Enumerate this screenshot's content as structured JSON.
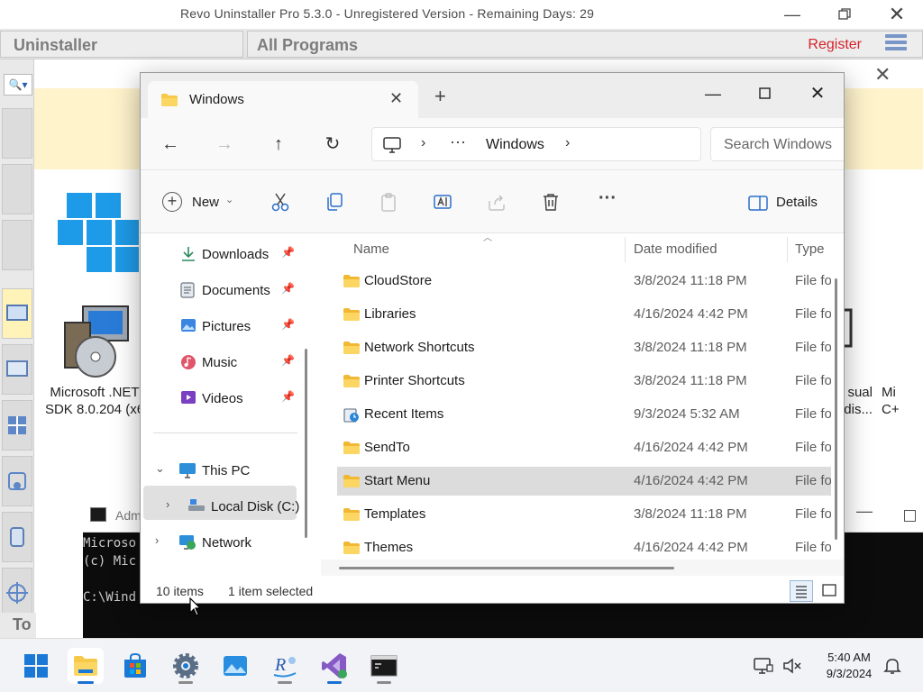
{
  "revo": {
    "title": "Revo Uninstaller Pro 5.3.0 - Unregistered Version - Remaining Days: 29",
    "uninstaller_tab": "Uninstaller",
    "all_programs_tab": "All Programs",
    "register": "Register",
    "programs": [
      {
        "label_line1": "Microsoft .NET",
        "label_line2": "SDK 8.0.204 (x6"
      },
      {
        "label_line1": "sual",
        "label_line2": "edis..."
      },
      {
        "label_line1": "Mi",
        "label_line2": "C+"
      }
    ],
    "bottom_label": "To"
  },
  "cmd": {
    "title": "Adm",
    "lines": [
      "Microso",
      "(c) Mic",
      "",
      "C:\\Wind"
    ]
  },
  "explorer": {
    "tab_title": "Windows",
    "new_tab": "+",
    "nav": {
      "back": "←",
      "forward": "→",
      "up": "↑",
      "refresh": "↻"
    },
    "address": {
      "ellipsis": "···",
      "crumb": "Windows"
    },
    "search_placeholder": "Search Windows",
    "toolbar": {
      "new_label": "New",
      "details_label": "Details",
      "more": "···"
    },
    "sidebar": {
      "quick": [
        {
          "label": "Downloads"
        },
        {
          "label": "Documents"
        },
        {
          "label": "Pictures"
        },
        {
          "label": "Music"
        },
        {
          "label": "Videos"
        }
      ],
      "this_pc": "This PC",
      "local_disk": "Local Disk (C:)",
      "network": "Network"
    },
    "columns": {
      "name": "Name",
      "date": "Date modified",
      "type": "Type"
    },
    "rows": [
      {
        "name": "CloudStore",
        "date": "3/8/2024 11:18 PM",
        "type": "File fo"
      },
      {
        "name": "Libraries",
        "date": "4/16/2024 4:42 PM",
        "type": "File fo"
      },
      {
        "name": "Network Shortcuts",
        "date": "3/8/2024 11:18 PM",
        "type": "File fo"
      },
      {
        "name": "Printer Shortcuts",
        "date": "3/8/2024 11:18 PM",
        "type": "File fo"
      },
      {
        "name": "Recent Items",
        "date": "9/3/2024 5:32 AM",
        "type": "File fo"
      },
      {
        "name": "SendTo",
        "date": "4/16/2024 4:42 PM",
        "type": "File fo"
      },
      {
        "name": "Start Menu",
        "date": "4/16/2024 4:42 PM",
        "type": "File fo"
      },
      {
        "name": "Templates",
        "date": "3/8/2024 11:18 PM",
        "type": "File fo"
      },
      {
        "name": "Themes",
        "date": "4/16/2024 4:42 PM",
        "type": "File fo"
      }
    ],
    "selected_row": "Start Menu",
    "status": {
      "count": "10 items",
      "selection": "1 item selected"
    }
  },
  "taskbar": {
    "time": "5:40 AM",
    "date": "9/3/2024",
    "apps": [
      "start-icon",
      "file-explorer-icon",
      "store-icon",
      "settings-icon",
      "photos-icon",
      "revo-uninstaller-icon",
      "visual-studio-installer-icon",
      "terminal-icon"
    ]
  },
  "colors": {
    "accent": "#1a6fd1",
    "folder": "#f7c948",
    "register": "#d3222a",
    "revo_banner": "#fff3cc"
  }
}
